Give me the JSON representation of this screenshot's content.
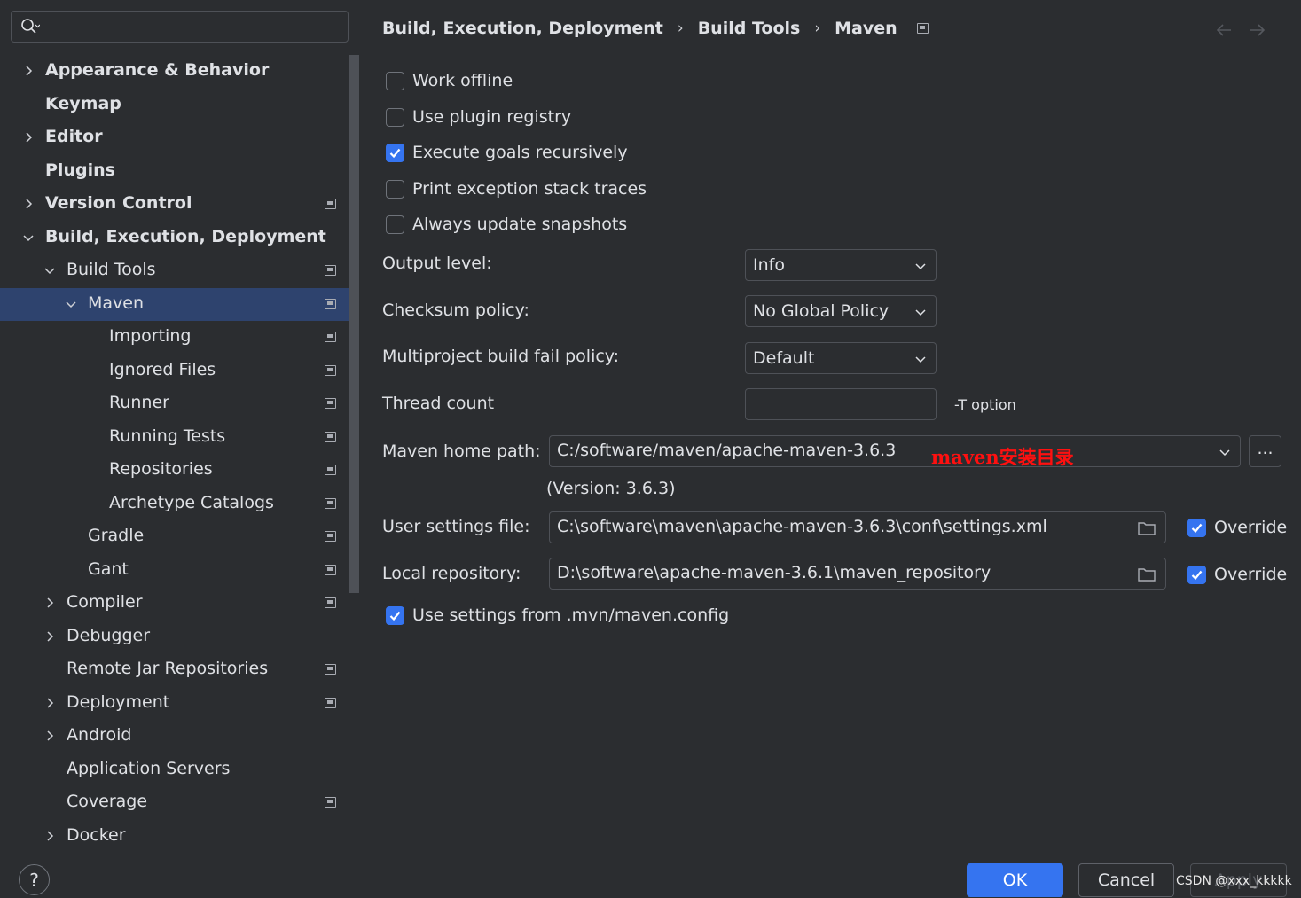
{
  "search": {
    "placeholder": ""
  },
  "sidebar": {
    "items": [
      {
        "label": "Appearance & Behavior",
        "chevron": "right",
        "bold": true
      },
      {
        "label": "Keymap",
        "chevron": "none",
        "bold": true
      },
      {
        "label": "Editor",
        "chevron": "right",
        "bold": true
      },
      {
        "label": "Plugins",
        "chevron": "none",
        "bold": true
      },
      {
        "label": "Version Control",
        "chevron": "right",
        "bold": true,
        "page_icon": true
      },
      {
        "label": "Build, Execution, Deployment",
        "chevron": "down",
        "bold": true
      },
      {
        "label": "Build Tools",
        "chevron": "down",
        "page_icon": true
      },
      {
        "label": "Maven",
        "chevron": "down",
        "page_icon": true,
        "selected": true
      },
      {
        "label": "Importing",
        "chevron": "none",
        "page_icon": true
      },
      {
        "label": "Ignored Files",
        "chevron": "none",
        "page_icon": true
      },
      {
        "label": "Runner",
        "chevron": "none",
        "page_icon": true
      },
      {
        "label": "Running Tests",
        "chevron": "none",
        "page_icon": true
      },
      {
        "label": "Repositories",
        "chevron": "none",
        "page_icon": true
      },
      {
        "label": "Archetype Catalogs",
        "chevron": "none",
        "page_icon": true
      },
      {
        "label": "Gradle",
        "chevron": "none",
        "page_icon": true
      },
      {
        "label": "Gant",
        "chevron": "none",
        "page_icon": true
      },
      {
        "label": "Compiler",
        "chevron": "right",
        "page_icon": true
      },
      {
        "label": "Debugger",
        "chevron": "right"
      },
      {
        "label": "Remote Jar Repositories",
        "chevron": "none",
        "page_icon": true
      },
      {
        "label": "Deployment",
        "chevron": "right",
        "page_icon": true
      },
      {
        "label": "Android",
        "chevron": "right"
      },
      {
        "label": "Application Servers",
        "chevron": "none"
      },
      {
        "label": "Coverage",
        "chevron": "none",
        "page_icon": true
      },
      {
        "label": "Docker",
        "chevron": "right"
      }
    ]
  },
  "breadcrumb": {
    "level1": "Build, Execution, Deployment",
    "level2": "Build Tools",
    "level3": "Maven",
    "separator": "›"
  },
  "options": {
    "work_offline": {
      "label": "Work offline",
      "checked": false
    },
    "use_plugin_registry": {
      "label": "Use plugin registry",
      "checked": false
    },
    "execute_goals_recursively": {
      "label": "Execute goals recursively",
      "checked": true
    },
    "print_exception_stack_traces": {
      "label": "Print exception stack traces",
      "checked": false
    },
    "always_update_snapshots": {
      "label": "Always update snapshots",
      "checked": false
    },
    "use_mvn_config": {
      "label": "Use settings from .mvn/maven.config",
      "checked": true
    }
  },
  "form": {
    "output_level_label": "Output level:",
    "output_level_value": "Info",
    "checksum_policy_label": "Checksum policy:",
    "checksum_policy_value": "No Global Policy",
    "fail_policy_label": "Multiproject build fail policy:",
    "fail_policy_value": "Default",
    "thread_count_label": "Thread count",
    "thread_count_value": "",
    "thread_count_hint": "-T option",
    "maven_home_label": "Maven home path:",
    "maven_home_value": "C:/software/maven/apache-maven-3.6.3",
    "maven_version": "(Version: 3.6.3)",
    "browse_label": "...",
    "user_settings_label": "User settings file:",
    "user_settings_value": "C:\\software\\maven\\apache-maven-3.6.3\\conf\\settings.xml",
    "user_settings_override": "Override",
    "local_repo_label": "Local repository:",
    "local_repo_value": "D:\\software\\apache-maven-3.6.1\\maven_repository",
    "local_repo_override": "Override"
  },
  "annotation": "maven安装目录",
  "footer": {
    "help": "?",
    "ok": "OK",
    "cancel": "Cancel",
    "apply": "Apply"
  },
  "watermark": "CSDN @xxx_kkkkk",
  "colors": {
    "accent": "#3574f0",
    "selection": "#2e436e",
    "background": "#2b2d30",
    "annotation": "#ff1010"
  }
}
